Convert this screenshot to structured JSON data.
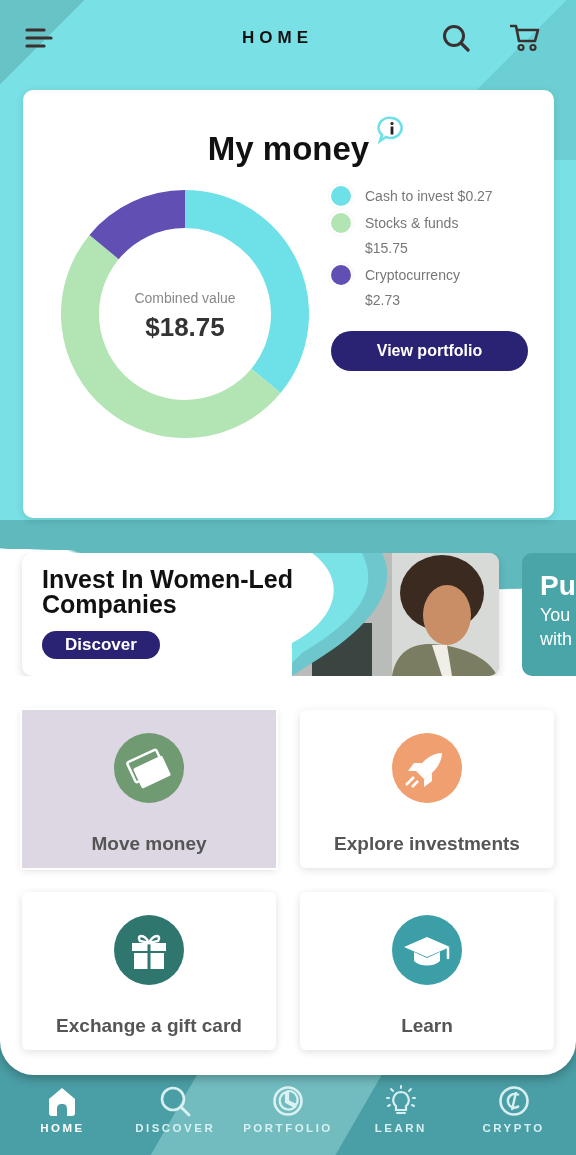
{
  "header": {
    "title": "HOME"
  },
  "money_card": {
    "title": "My money",
    "center_label": "Combined value",
    "center_amount": "$18.75",
    "legend": [
      {
        "label": "Cash to invest",
        "amount": "$0.27",
        "color": "#6ee0e8"
      },
      {
        "label": "Stocks & funds",
        "amount": "$15.75",
        "color": "#b3e4b4"
      },
      {
        "label": "Cryptocurrency",
        "amount": "$2.73",
        "color": "#624fb4"
      }
    ],
    "button": "View portfolio"
  },
  "promos": [
    {
      "title": "Invest In Women-Led Companies",
      "button": "Discover"
    },
    {
      "kind": "plain",
      "title": "Pu",
      "lines": [
        "You",
        "with"
      ]
    }
  ],
  "tiles": [
    {
      "kind": "cards",
      "label": "Move money",
      "color": "#6f9a72",
      "selected": true
    },
    {
      "kind": "rocket",
      "label": "Explore investments",
      "color": "#f0a070",
      "selected": false
    },
    {
      "kind": "gift",
      "label": "Exchange a gift card",
      "color": "#2f766e",
      "selected": false
    },
    {
      "kind": "cap",
      "label": "Learn",
      "color": "#3c9ea6",
      "selected": false
    }
  ],
  "nav": [
    {
      "kind": "home",
      "label": "HOME",
      "selected": true
    },
    {
      "kind": "search",
      "label": "DISCOVER",
      "selected": false
    },
    {
      "kind": "pie",
      "label": "PORTFOLIO",
      "selected": false
    },
    {
      "kind": "bulb",
      "label": "LEARN",
      "selected": false
    },
    {
      "kind": "coin",
      "label": "CRYPTO",
      "selected": false
    }
  ]
}
